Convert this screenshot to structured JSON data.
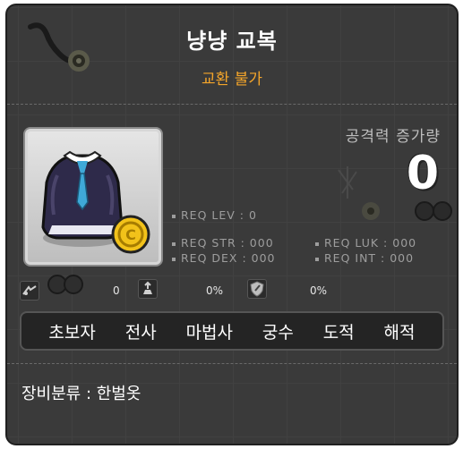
{
  "item": {
    "name": "냥냥 교복",
    "trade_status": "교환 불가",
    "attack_increase_label": "공격력 증가량",
    "attack_increase_value": "0"
  },
  "requirements": {
    "lev": "REQ LEV :    0",
    "str": "REQ STR : 000",
    "luk": "REQ LUK : 000",
    "dex": "REQ DEX : 000",
    "int": "REQ INT : 000"
  },
  "icons_row": {
    "first_value": "0",
    "second_value": "0%",
    "third_value": "0%"
  },
  "jobs": [
    "초보자",
    "전사",
    "마법사",
    "궁수",
    "도적",
    "해적"
  ],
  "category": "장비분류 : 한벌옷",
  "colors": {
    "background": "#3a3a3a",
    "trade_status": "#f4a52a",
    "stat_text": "#9d9d9d"
  }
}
